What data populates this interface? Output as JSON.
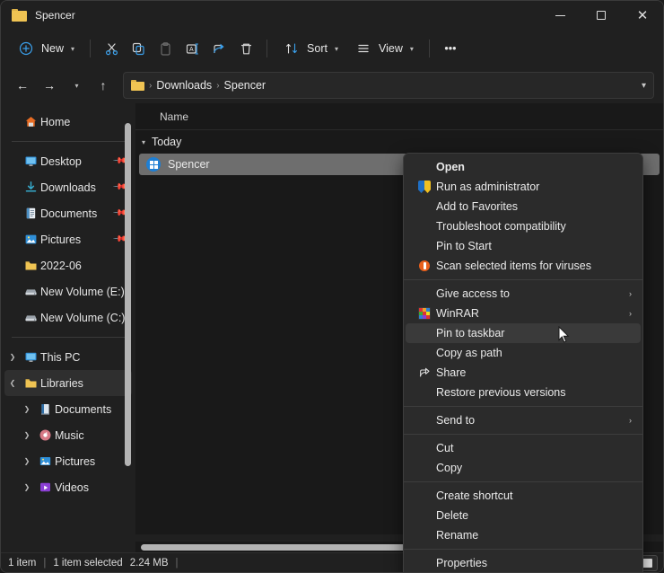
{
  "window": {
    "title": "Spencer",
    "controls": {
      "minimize": "─",
      "maximize": "□",
      "close": "✕"
    }
  },
  "toolbar": {
    "new_label": "New",
    "new_icon": "plus-circle-icon",
    "items": [
      {
        "name": "cut-button",
        "icon": "scissors-icon",
        "label": ""
      },
      {
        "name": "copy-button",
        "icon": "copy-icon",
        "label": ""
      },
      {
        "name": "paste-button",
        "icon": "clipboard-icon",
        "label": ""
      },
      {
        "name": "rename-button",
        "icon": "rename-icon",
        "label": ""
      },
      {
        "name": "share-button",
        "icon": "share-icon",
        "label": ""
      },
      {
        "name": "delete-button",
        "icon": "trash-icon",
        "label": ""
      }
    ],
    "sort_label": "Sort",
    "view_label": "View",
    "more_label": "•••"
  },
  "address": {
    "back_icon": "arrow-left-icon",
    "forward_icon": "arrow-right-icon",
    "recent_icon": "chevron-down-icon",
    "up_icon": "arrow-up-icon",
    "crumbs": [
      "Downloads",
      "Spencer"
    ],
    "separator": "›",
    "dropdown_icon": "chevron-down-icon"
  },
  "sidebar": {
    "home": {
      "label": "Home",
      "icon": "home-icon"
    },
    "quick_access": [
      {
        "label": "Desktop",
        "icon": "desktop-icon",
        "pinned": true
      },
      {
        "label": "Downloads",
        "icon": "downloads-icon",
        "pinned": true
      },
      {
        "label": "Documents",
        "icon": "documents-icon",
        "pinned": true
      },
      {
        "label": "Pictures",
        "icon": "pictures-icon",
        "pinned": true
      },
      {
        "label": "2022-06",
        "icon": "folder-icon",
        "pinned": false
      },
      {
        "label": "New Volume (E:)",
        "icon": "drive-icon",
        "pinned": false
      },
      {
        "label": "New Volume (C:)",
        "icon": "drive-icon",
        "pinned": false
      }
    ],
    "tree": [
      {
        "label": "This PC",
        "icon": "pc-icon",
        "expanded": false,
        "selected": false,
        "indent": 0
      },
      {
        "label": "Libraries",
        "icon": "folder-icon",
        "expanded": true,
        "selected": true,
        "indent": 0
      },
      {
        "label": "Documents",
        "icon": "documents-library-icon",
        "expanded": false,
        "selected": false,
        "indent": 1
      },
      {
        "label": "Music",
        "icon": "music-icon",
        "expanded": false,
        "selected": false,
        "indent": 1
      },
      {
        "label": "Pictures",
        "icon": "pictures-library-icon",
        "expanded": false,
        "selected": false,
        "indent": 1
      },
      {
        "label": "Videos",
        "icon": "videos-icon",
        "expanded": false,
        "selected": false,
        "indent": 1
      }
    ]
  },
  "filelist": {
    "column_header": "Name",
    "group_label": "Today",
    "group_chevron": "⌄",
    "rows": [
      {
        "name": "Spencer",
        "icon": "windows-app-icon",
        "selected": true
      }
    ]
  },
  "context_menu": {
    "items": [
      {
        "label": "Open",
        "icon": "",
        "bold": true,
        "arrow": false,
        "hovered": false
      },
      {
        "label": "Run as administrator",
        "icon": "shield-icon",
        "bold": false,
        "arrow": false,
        "hovered": false
      },
      {
        "label": "Add to Favorites",
        "icon": "",
        "bold": false,
        "arrow": false,
        "hovered": false
      },
      {
        "label": "Troubleshoot compatibility",
        "icon": "",
        "bold": false,
        "arrow": false,
        "hovered": false
      },
      {
        "label": "Pin to Start",
        "icon": "",
        "bold": false,
        "arrow": false,
        "hovered": false
      },
      {
        "label": "Scan selected items for viruses",
        "icon": "antivirus-icon",
        "bold": false,
        "arrow": false,
        "hovered": false
      },
      {
        "separator": true
      },
      {
        "label": "Give access to",
        "icon": "",
        "bold": false,
        "arrow": true,
        "hovered": false
      },
      {
        "label": "WinRAR",
        "icon": "winrar-icon",
        "bold": false,
        "arrow": true,
        "hovered": false
      },
      {
        "label": "Pin to taskbar",
        "icon": "",
        "bold": false,
        "arrow": false,
        "hovered": true
      },
      {
        "label": "Copy as path",
        "icon": "",
        "bold": false,
        "arrow": false,
        "hovered": false
      },
      {
        "label": "Share",
        "icon": "share-icon",
        "bold": false,
        "arrow": false,
        "hovered": false
      },
      {
        "label": "Restore previous versions",
        "icon": "",
        "bold": false,
        "arrow": false,
        "hovered": false
      },
      {
        "separator": true
      },
      {
        "label": "Send to",
        "icon": "",
        "bold": false,
        "arrow": true,
        "hovered": false
      },
      {
        "separator": true
      },
      {
        "label": "Cut",
        "icon": "",
        "bold": false,
        "arrow": false,
        "hovered": false
      },
      {
        "label": "Copy",
        "icon": "",
        "bold": false,
        "arrow": false,
        "hovered": false
      },
      {
        "separator": true
      },
      {
        "label": "Create shortcut",
        "icon": "",
        "bold": false,
        "arrow": false,
        "hovered": false
      },
      {
        "label": "Delete",
        "icon": "",
        "bold": false,
        "arrow": false,
        "hovered": false
      },
      {
        "label": "Rename",
        "icon": "",
        "bold": false,
        "arrow": false,
        "hovered": false
      },
      {
        "separator": true
      },
      {
        "label": "Properties",
        "icon": "",
        "bold": false,
        "arrow": false,
        "hovered": false
      }
    ],
    "submenu_arrow": "›"
  },
  "statusbar": {
    "item_count": "1 item",
    "divider": "|",
    "selection": "1 item selected",
    "size": "2.24 MB",
    "trailing_divider": "|",
    "view_details_icon": "details-view-icon",
    "view_large_icon": "large-icons-view-icon"
  },
  "colors": {
    "accent": "#1e7fd4",
    "folder": "#f0c453",
    "selection": "#6e6e6e",
    "window_bg": "#202020",
    "list_bg": "#191919",
    "menu_bg": "#2b2b2b"
  }
}
